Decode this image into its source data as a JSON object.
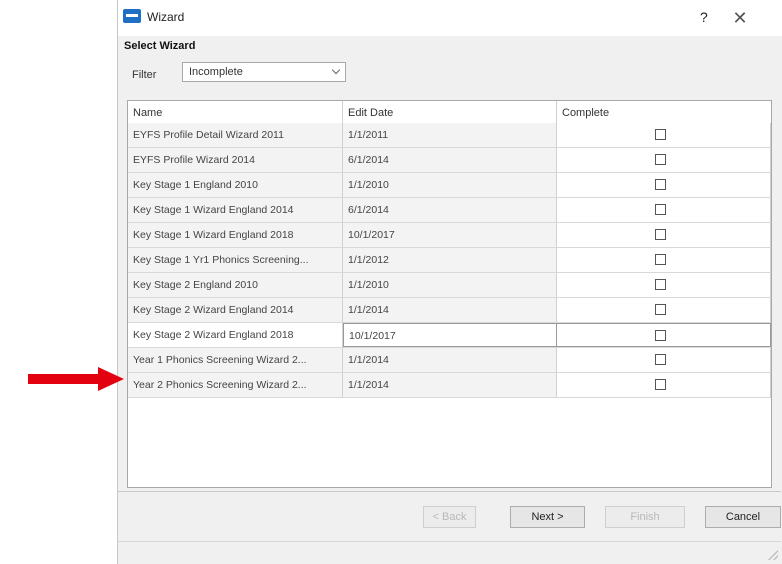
{
  "window": {
    "title": "Wizard",
    "help": "?",
    "close": "✕"
  },
  "section_title": "Select Wizard",
  "filter": {
    "label": "Filter",
    "value": "Incomplete"
  },
  "grid": {
    "columns": [
      "Name",
      "Edit Date",
      "Complete"
    ],
    "rows": [
      {
        "name": "EYFS Profile Detail Wizard 2011",
        "date": "1/1/2011",
        "complete": false
      },
      {
        "name": "EYFS Profile Wizard 2014",
        "date": "6/1/2014",
        "complete": false
      },
      {
        "name": "Key Stage 1 England 2010",
        "date": "1/1/2010",
        "complete": false
      },
      {
        "name": "Key Stage 1 Wizard England 2014",
        "date": "6/1/2014",
        "complete": false
      },
      {
        "name": "Key Stage 1 Wizard England 2018",
        "date": "10/1/2017",
        "complete": false
      },
      {
        "name": "Key Stage 1 Yr1 Phonics Screening...",
        "date": "1/1/2012",
        "complete": false
      },
      {
        "name": "Key Stage 2 England 2010",
        "date": "1/1/2010",
        "complete": false
      },
      {
        "name": "Key Stage 2 Wizard England 2014",
        "date": "1/1/2014",
        "complete": false
      },
      {
        "name": "Key Stage 2 Wizard England 2018",
        "date": "10/1/2017",
        "complete": false
      },
      {
        "name": "Year 1 Phonics Screening Wizard 2...",
        "date": "1/1/2014",
        "complete": false
      },
      {
        "name": "Year 2 Phonics Screening Wizard 2...",
        "date": "1/1/2014",
        "complete": false
      }
    ]
  },
  "buttons": {
    "back": "< Back",
    "next": "Next >",
    "finish": "Finish",
    "cancel": "Cancel"
  },
  "colors": {
    "arrow": "#e3000f",
    "app_icon": "#1f6fc5"
  }
}
